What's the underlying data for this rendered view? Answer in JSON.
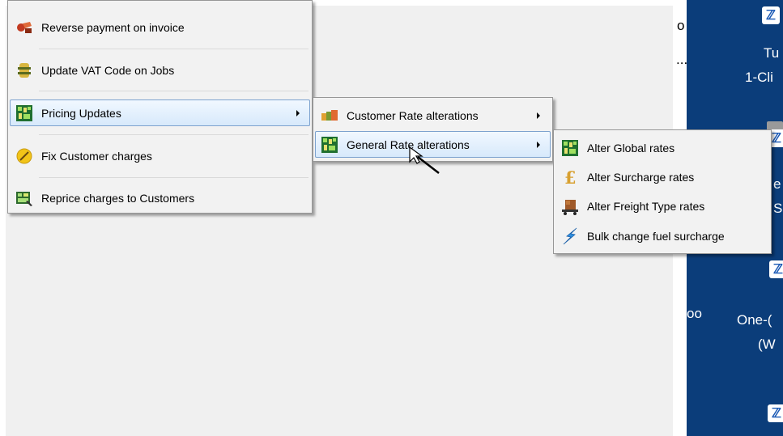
{
  "desktop": {
    "fragments": [
      {
        "text": "o"
      },
      {
        "text": "..."
      },
      {
        "text": "Tu"
      },
      {
        "text": "1-Cli"
      },
      {
        "text": "e"
      },
      {
        "text": "S"
      },
      {
        "text": "oo"
      },
      {
        "text": "One-("
      },
      {
        "text": "(W"
      }
    ]
  },
  "main_menu": {
    "items": [
      {
        "label": "Reverse payment on invoice",
        "icon": "reverse-payment-icon"
      },
      {
        "label": "Update VAT Code on Jobs",
        "icon": "vat-code-icon"
      },
      {
        "label": "Pricing Updates",
        "icon": "pricing-updates-icon",
        "submenu": true,
        "highlighted": true
      },
      {
        "label": "Fix Customer charges",
        "icon": "fix-charges-icon"
      },
      {
        "label": "Reprice charges to Customers",
        "icon": "reprice-icon"
      }
    ]
  },
  "pricing_submenu": {
    "items": [
      {
        "label": "Customer Rate alterations",
        "icon": "customer-rate-icon",
        "submenu": true
      },
      {
        "label": "General Rate alterations",
        "icon": "general-rate-icon",
        "submenu": true,
        "highlighted": true
      }
    ]
  },
  "general_rate_submenu": {
    "items": [
      {
        "label": "Alter Global rates",
        "icon": "global-rates-icon"
      },
      {
        "label": "Alter Surcharge rates",
        "icon": "pound-sign-icon"
      },
      {
        "label": "Alter Freight Type rates",
        "icon": "freight-cart-icon"
      },
      {
        "label": "Bulk change fuel surcharge",
        "icon": "lightning-icon"
      }
    ]
  },
  "colors": {
    "highlight_border": "#7da2ce",
    "menu_background": "#f2f2f2",
    "desktop_background": "#0b3d7a"
  }
}
